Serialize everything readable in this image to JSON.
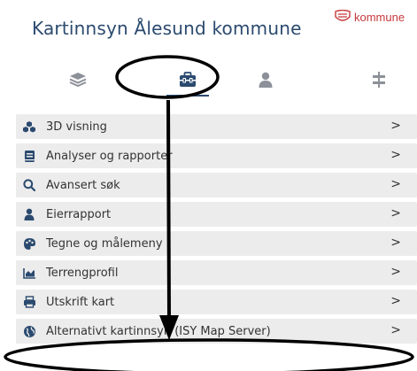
{
  "header": {
    "title": "Kartinnsyn Ålesund kommune",
    "logo_text": "kommune"
  },
  "tabs": [
    {
      "name": "layers",
      "icon": "layers-icon"
    },
    {
      "name": "tools",
      "icon": "toolbox-icon",
      "active": true
    },
    {
      "name": "user",
      "icon": "user-icon"
    },
    {
      "name": "settings",
      "icon": "sliders-icon"
    }
  ],
  "menu": {
    "items": [
      {
        "label": "3D visning",
        "icon": "cubes-icon"
      },
      {
        "label": "Analyser og rapporter",
        "icon": "book-icon"
      },
      {
        "label": "Avansert søk",
        "icon": "search-icon"
      },
      {
        "label": "Eierrapport",
        "icon": "user-icon"
      },
      {
        "label": "Tegne og målemeny",
        "icon": "palette-icon"
      },
      {
        "label": "Terrengprofil",
        "icon": "area-chart-icon"
      },
      {
        "label": "Utskrift kart",
        "icon": "print-icon"
      },
      {
        "label": "Alternativt kartinnsyn (ISY Map Server)",
        "icon": "globe-icon"
      }
    ],
    "chevron": ">"
  },
  "colors": {
    "title": "#2b4a6f",
    "icon": "#2b4a6f",
    "tab_icon_inactive": "#8c9099",
    "item_bg": "#ececec",
    "logo": "#c8383b"
  }
}
